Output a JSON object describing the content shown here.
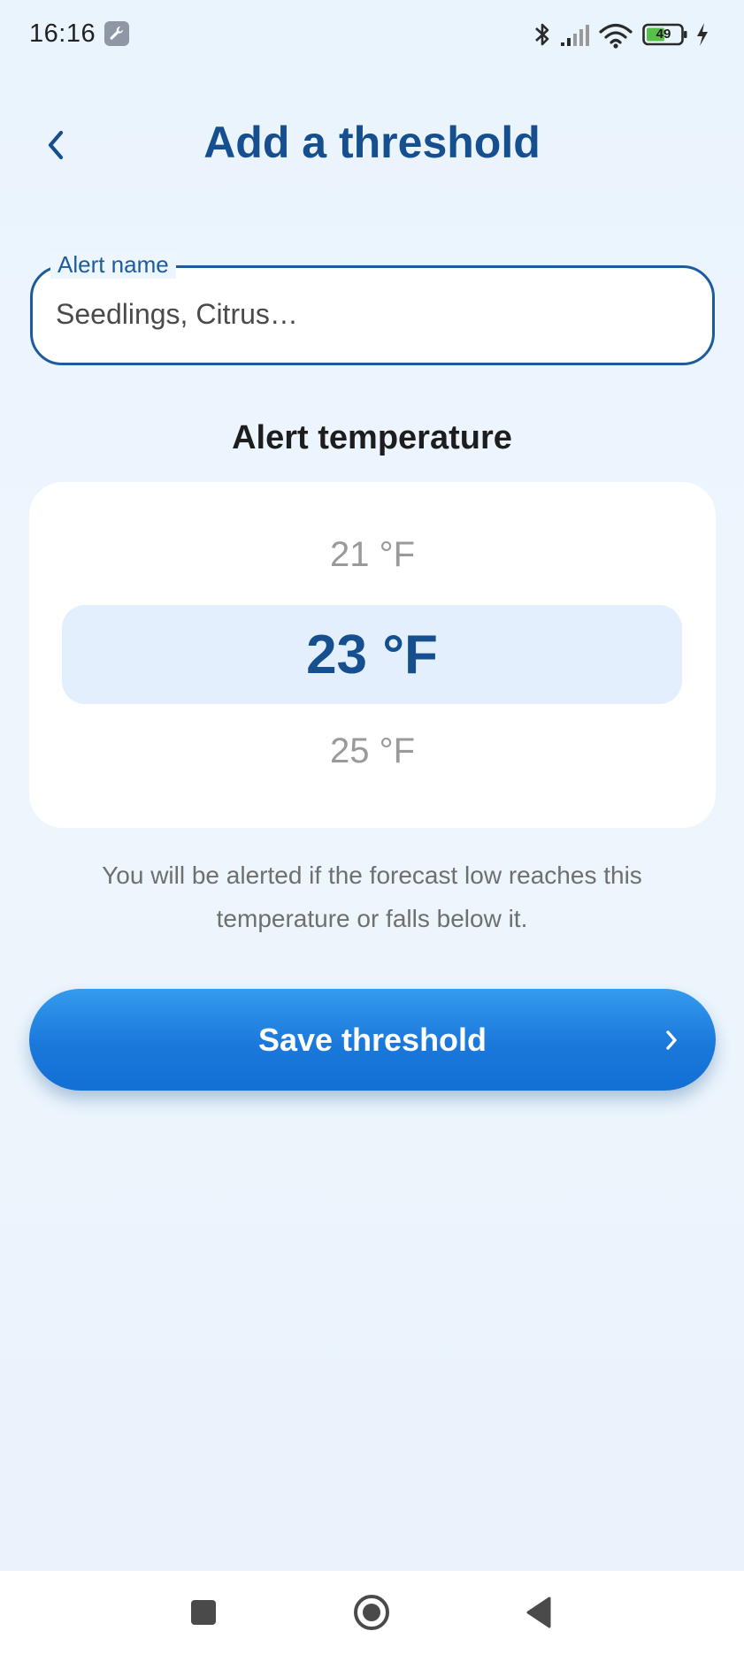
{
  "status_bar": {
    "time": "16:16",
    "battery_level": "49",
    "icons": [
      "wrench-icon",
      "bluetooth-icon",
      "signal-icon",
      "wifi-icon",
      "battery-icon",
      "charging-icon"
    ]
  },
  "header": {
    "title": "Add a threshold",
    "back_icon": "chevron-left-icon"
  },
  "alert_name_field": {
    "label": "Alert name",
    "value": "",
    "placeholder": "Seedlings, Citrus…"
  },
  "temperature": {
    "section_title": "Alert temperature",
    "options": [
      "21 °F",
      "23 °F",
      "25 °F"
    ],
    "selected": "23 °F",
    "helper_text": "You will be alerted if the forecast low reaches this temperature or falls below it."
  },
  "save_button": {
    "label": "Save threshold",
    "icon": "chevron-right-icon"
  },
  "nav_bar": {
    "icons": [
      "recents-square-icon",
      "home-circle-icon",
      "back-triangle-icon"
    ]
  },
  "colors": {
    "primary": "#164f8f",
    "button": "#1a78db",
    "background": "#eaf4fd",
    "selected_row": "#e3effc"
  }
}
